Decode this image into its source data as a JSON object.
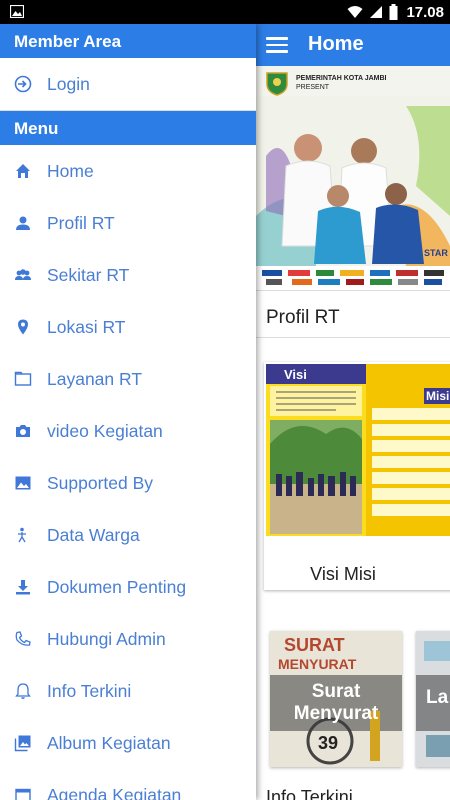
{
  "status_bar": {
    "time": "17.08"
  },
  "app": {
    "title": "Home",
    "banner": {
      "org_text": "PEMERINTAH KOTA JAMBI",
      "sub_text": "PRESENT"
    },
    "section_profil": "Profil RT",
    "card_visi": {
      "caption": "Visi Misi",
      "visi_label": "Visi",
      "misi_label": "Misi"
    },
    "card_surat": {
      "line1": "Surat",
      "line2": "Menyurat"
    },
    "card_partial_label": "La",
    "section_info": "Info Terkini"
  },
  "drawer": {
    "member_area": "Member Area",
    "login": "Login",
    "menu_header": "Menu",
    "items": [
      {
        "label": "Home",
        "icon": "home-icon"
      },
      {
        "label": "Profil RT",
        "icon": "person-icon"
      },
      {
        "label": "Sekitar RT",
        "icon": "group-icon"
      },
      {
        "label": "Lokasi RT",
        "icon": "location-pin-icon"
      },
      {
        "label": "Layanan RT",
        "icon": "folder-icon"
      },
      {
        "label": "video Kegiatan",
        "icon": "camera-icon"
      },
      {
        "label": "Supported By",
        "icon": "image-icon"
      },
      {
        "label": "Data Warga",
        "icon": "person-stand-icon"
      },
      {
        "label": "Dokumen Penting",
        "icon": "download-icon"
      },
      {
        "label": "Hubungi Admin",
        "icon": "phone-icon"
      },
      {
        "label": "Info Terkini",
        "icon": "bell-icon"
      },
      {
        "label": "Album Kegiatan",
        "icon": "photo-library-icon"
      },
      {
        "label": "Agenda Kegiatan",
        "icon": "calendar-icon"
      }
    ]
  },
  "colors": {
    "primary": "#2c7de6",
    "drawer_text": "#4a7fd4",
    "icon": "#3f78d8"
  }
}
